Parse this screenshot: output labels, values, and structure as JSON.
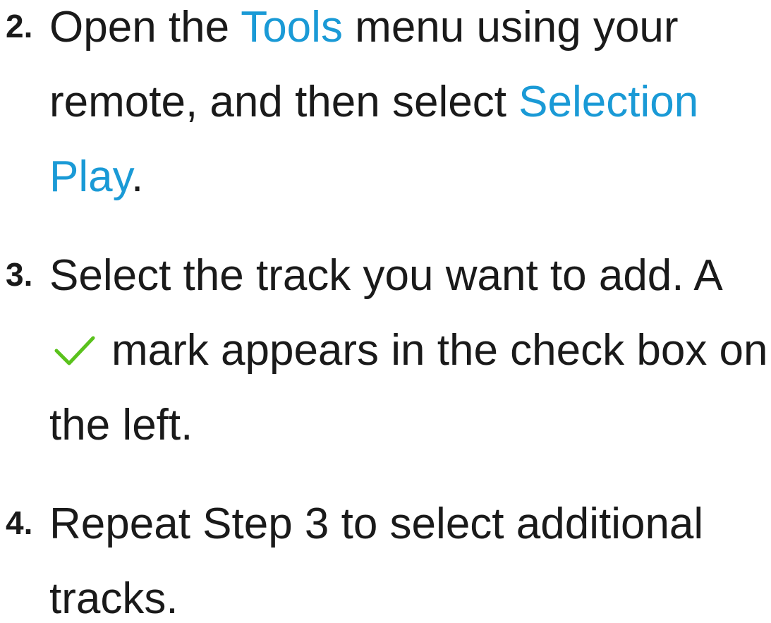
{
  "steps": [
    {
      "number": "2.",
      "lines": [
        {
          "t1": "Open the ",
          "k1": "Tools",
          "t2": " menu using your"
        },
        {
          "t1": "remote, and then select ",
          "k1": "Selection"
        },
        {
          "k1": "Play",
          "t2": "."
        }
      ]
    },
    {
      "number": "3.",
      "lines": [
        {
          "t1": "Select the track you want to add. A"
        },
        {
          "icon": "checkmark-icon",
          "t2": "mark appears in the check box on"
        },
        {
          "t1": "the left."
        }
      ]
    },
    {
      "number": "4.",
      "lines": [
        {
          "t1": "Repeat Step 3 to select additional"
        },
        {
          "t1": "tracks."
        }
      ]
    }
  ],
  "colors": {
    "text": "#1a1a1a",
    "keyword": "#1a9ad6",
    "checkmark": "#5ac21c"
  }
}
